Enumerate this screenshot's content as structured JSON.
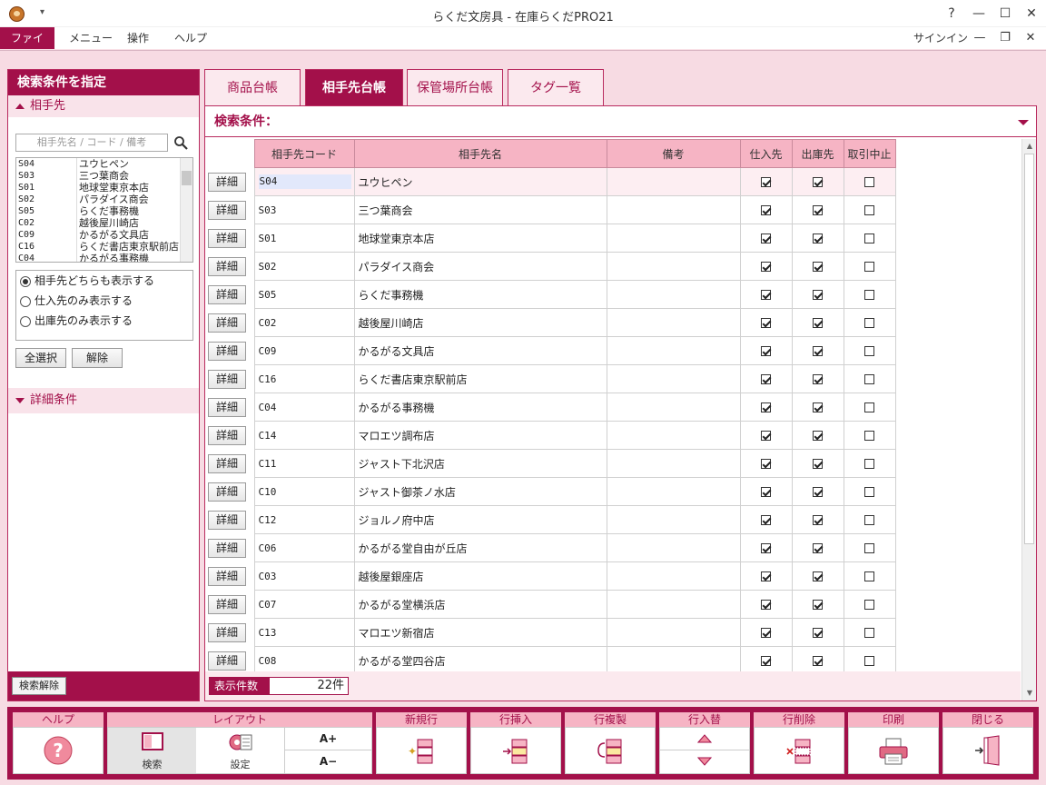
{
  "window": {
    "title": "らくだ文房具 - 在庫らくだPRO21",
    "help_glyph": "?",
    "minimize_glyph": "—",
    "maximize_glyph": "☐",
    "close_glyph": "✕"
  },
  "menubar": {
    "items": [
      "ファイル",
      "メニュー",
      "操作",
      "ヘルプ"
    ],
    "signin": "サインイン",
    "mini_minimize": "—",
    "mini_restore": "❐",
    "mini_close": "✕"
  },
  "left": {
    "header": "検索条件を指定",
    "section_partner": "相手先",
    "search_placeholder": "相手先名 / コード / 備考",
    "partners": [
      {
        "code": "S04",
        "name": "ユウヒペン"
      },
      {
        "code": "S03",
        "name": "三つ葉商会"
      },
      {
        "code": "S01",
        "name": "地球堂東京本店"
      },
      {
        "code": "S02",
        "name": "パラダイス商会"
      },
      {
        "code": "S05",
        "name": "らくだ事務機"
      },
      {
        "code": "C02",
        "name": "越後屋川崎店"
      },
      {
        "code": "C09",
        "name": "かるがる文具店"
      },
      {
        "code": "C16",
        "name": "らくだ書店東京駅前店"
      },
      {
        "code": "C04",
        "name": "かるがる事務機"
      }
    ],
    "radio_options": [
      "相手先どちらも表示する",
      "仕入先のみ表示する",
      "出庫先のみ表示する"
    ],
    "select_all": "全選択",
    "deselect": "解除",
    "section_detail": "詳細条件",
    "clear_search": "検索解除"
  },
  "tabs": [
    "商品台帳",
    "相手先台帳",
    "保管場所台帳",
    "タグ一覧"
  ],
  "main": {
    "condition_label": "検索条件：",
    "columns": [
      "相手先コード",
      "相手先名",
      "備考",
      "仕入先",
      "出庫先",
      "取引中止"
    ],
    "detail_label": "詳細",
    "rows": [
      {
        "code": "S04",
        "name": "ユウヒペン",
        "note": "",
        "supplier": true,
        "outbound": true,
        "stopped": false
      },
      {
        "code": "S03",
        "name": "三つ葉商会",
        "note": "",
        "supplier": true,
        "outbound": true,
        "stopped": false
      },
      {
        "code": "S01",
        "name": "地球堂東京本店",
        "note": "",
        "supplier": true,
        "outbound": true,
        "stopped": false
      },
      {
        "code": "S02",
        "name": "パラダイス商会",
        "note": "",
        "supplier": true,
        "outbound": true,
        "stopped": false
      },
      {
        "code": "S05",
        "name": "らくだ事務機",
        "note": "",
        "supplier": true,
        "outbound": true,
        "stopped": false
      },
      {
        "code": "C02",
        "name": "越後屋川崎店",
        "note": "",
        "supplier": true,
        "outbound": true,
        "stopped": false
      },
      {
        "code": "C09",
        "name": "かるがる文具店",
        "note": "",
        "supplier": true,
        "outbound": true,
        "stopped": false
      },
      {
        "code": "C16",
        "name": "らくだ書店東京駅前店",
        "note": "",
        "supplier": true,
        "outbound": true,
        "stopped": false
      },
      {
        "code": "C04",
        "name": "かるがる事務機",
        "note": "",
        "supplier": true,
        "outbound": true,
        "stopped": false
      },
      {
        "code": "C14",
        "name": "マロエツ調布店",
        "note": "",
        "supplier": true,
        "outbound": true,
        "stopped": false
      },
      {
        "code": "C11",
        "name": "ジャスト下北沢店",
        "note": "",
        "supplier": true,
        "outbound": true,
        "stopped": false
      },
      {
        "code": "C10",
        "name": "ジャスト御茶ノ水店",
        "note": "",
        "supplier": true,
        "outbound": true,
        "stopped": false
      },
      {
        "code": "C12",
        "name": "ジョルノ府中店",
        "note": "",
        "supplier": true,
        "outbound": true,
        "stopped": false
      },
      {
        "code": "C06",
        "name": "かるがる堂自由が丘店",
        "note": "",
        "supplier": true,
        "outbound": true,
        "stopped": false
      },
      {
        "code": "C03",
        "name": "越後屋銀座店",
        "note": "",
        "supplier": true,
        "outbound": true,
        "stopped": false
      },
      {
        "code": "C07",
        "name": "かるがる堂横浜店",
        "note": "",
        "supplier": true,
        "outbound": true,
        "stopped": false
      },
      {
        "code": "C13",
        "name": "マロエツ新宿店",
        "note": "",
        "supplier": true,
        "outbound": true,
        "stopped": false
      },
      {
        "code": "C08",
        "name": "かるがる堂四谷店",
        "note": "",
        "supplier": true,
        "outbound": true,
        "stopped": false
      }
    ],
    "count_label": "表示件数",
    "count_value": "22件"
  },
  "toolbar": {
    "help": "ヘルプ",
    "layout": "レイアウト",
    "search": "検索",
    "settings": "設定",
    "font_up": "A+",
    "font_down": "A−",
    "new_row": "新規行",
    "insert_row": "行挿入",
    "copy_row": "行複製",
    "swap_row": "行入替",
    "delete_row": "行削除",
    "print": "印刷",
    "close": "閉じる"
  },
  "colors": {
    "accent": "#a3104a",
    "header_pink": "#f6b4c4",
    "background_pink": "#f7dbe3"
  }
}
